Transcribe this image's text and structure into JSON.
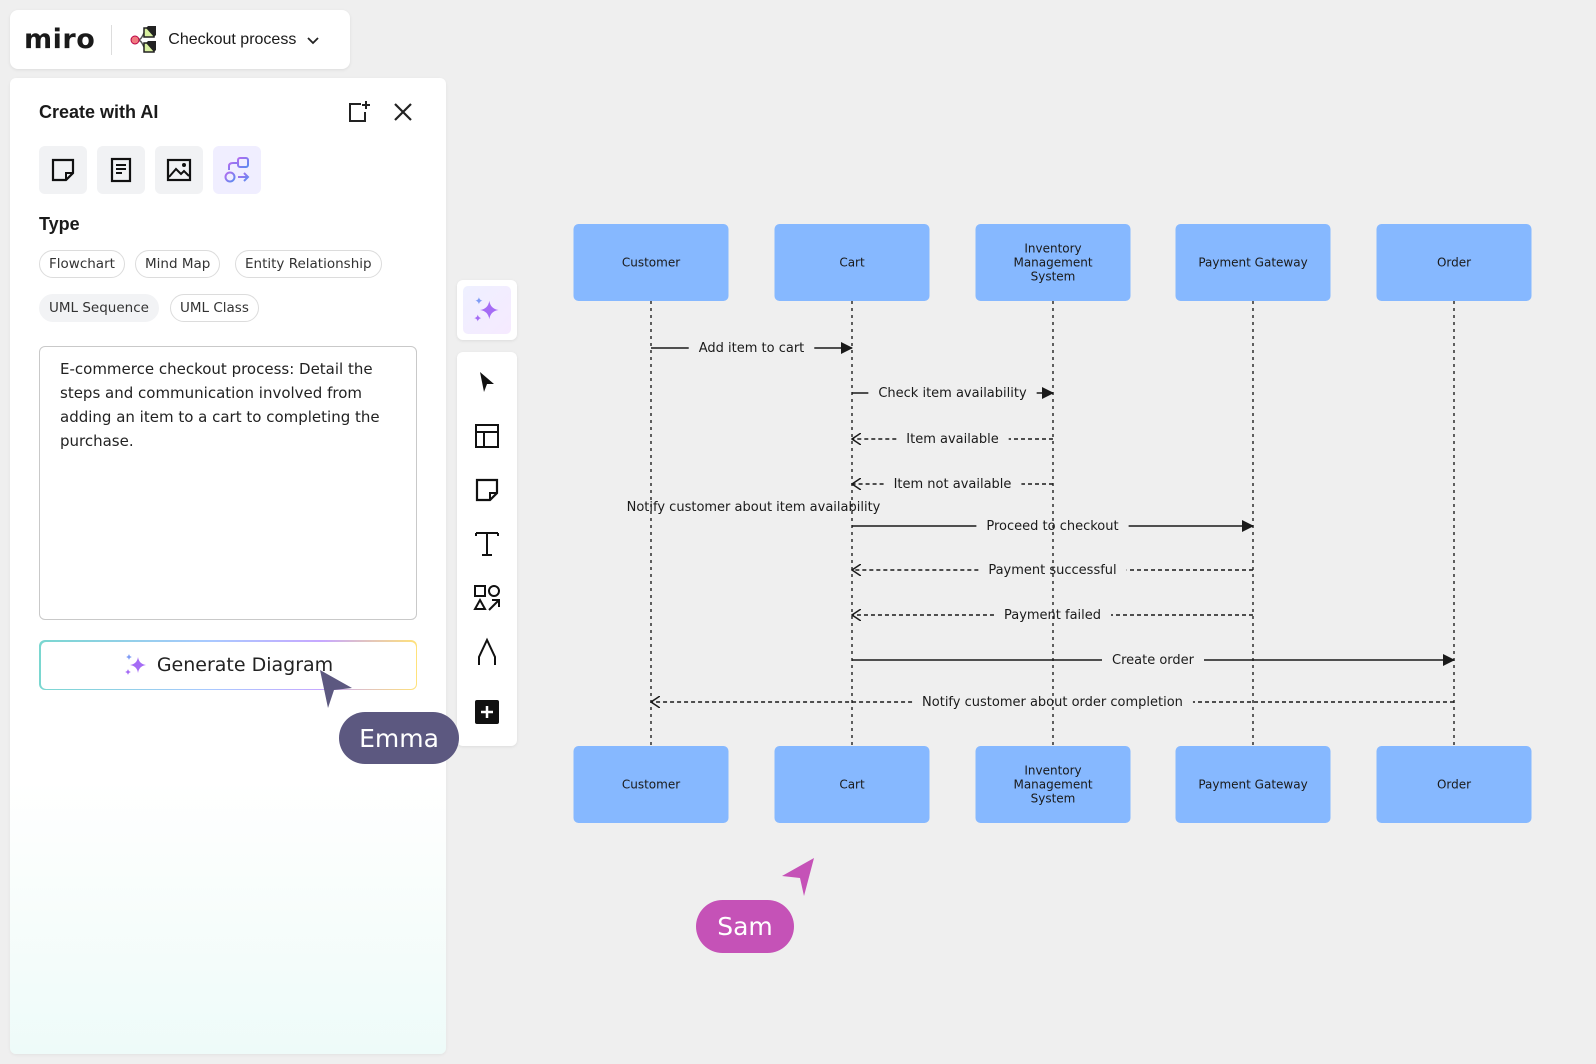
{
  "header": {
    "logo": "miro",
    "board_title": "Checkout process",
    "board_icon": "diagram-board-icon",
    "dropdown_icon": "chevron-down-icon"
  },
  "panel": {
    "title": "Create with AI",
    "header_icons": [
      "new-frame-icon",
      "close-icon"
    ],
    "modes": [
      {
        "name": "sticky-note",
        "icon": "sticky-note-icon",
        "active": false
      },
      {
        "name": "document",
        "icon": "document-icon",
        "active": false
      },
      {
        "name": "image",
        "icon": "image-icon",
        "active": false
      },
      {
        "name": "diagram",
        "icon": "diagram-icon",
        "active": true
      }
    ],
    "type_label": "Type",
    "types": [
      {
        "label": "Flowchart",
        "active": false
      },
      {
        "label": "Mind Map",
        "active": false
      },
      {
        "label": "Entity Relationship",
        "active": false
      },
      {
        "label": "UML Sequence",
        "active": true
      },
      {
        "label": "UML Class",
        "active": false
      }
    ],
    "prompt_value": "E-commerce checkout process: Detail the steps and communication involved from adding an item to a cart to completing the purchase.",
    "generate_label": "Generate Diagram"
  },
  "toolbar": {
    "ai_button": "sparkle-icon",
    "tools": [
      "select-cursor-icon",
      "templates-icon",
      "sticky-note-icon",
      "text-icon",
      "shapes-icon",
      "pen-icon",
      "add-more-icon"
    ]
  },
  "colors": {
    "participant_fill": "#86b8ff",
    "accent_purple": "#9b6cf5",
    "emma_cursor": "#5c5880",
    "sam_cursor": "#c552b7"
  },
  "diagram": {
    "type": "uml-sequence",
    "participants": [
      "Customer",
      "Cart",
      "Inventory Management System",
      "Payment Gateway",
      "Order"
    ],
    "participant_lines": [
      [
        "Customer"
      ],
      [
        "Cart"
      ],
      [
        "Inventory",
        "Management",
        "System"
      ],
      [
        "Payment Gateway"
      ],
      [
        "Order"
      ]
    ],
    "messages": [
      {
        "from": 0,
        "to": 1,
        "label": "Add item to cart",
        "style": "sync"
      },
      {
        "from": 1,
        "to": 2,
        "label": "Check item availability",
        "style": "sync"
      },
      {
        "from": 2,
        "to": 1,
        "label": "Item available",
        "style": "return"
      },
      {
        "from": 2,
        "to": 1,
        "label": "Item not available",
        "style": "return"
      },
      {
        "from": 1,
        "to": 0,
        "label": "Notify customer about item availability",
        "style": "note"
      },
      {
        "from": 1,
        "to": 3,
        "label": "Proceed to checkout",
        "style": "sync"
      },
      {
        "from": 3,
        "to": 1,
        "label": "Payment successful",
        "style": "return"
      },
      {
        "from": 3,
        "to": 1,
        "label": "Payment failed",
        "style": "return"
      },
      {
        "from": 1,
        "to": 4,
        "label": "Create order",
        "style": "sync"
      },
      {
        "from": 4,
        "to": 0,
        "label": "Notify customer about order completion",
        "style": "return"
      }
    ]
  },
  "collaborators": [
    {
      "name": "Emma"
    },
    {
      "name": "Sam"
    }
  ]
}
